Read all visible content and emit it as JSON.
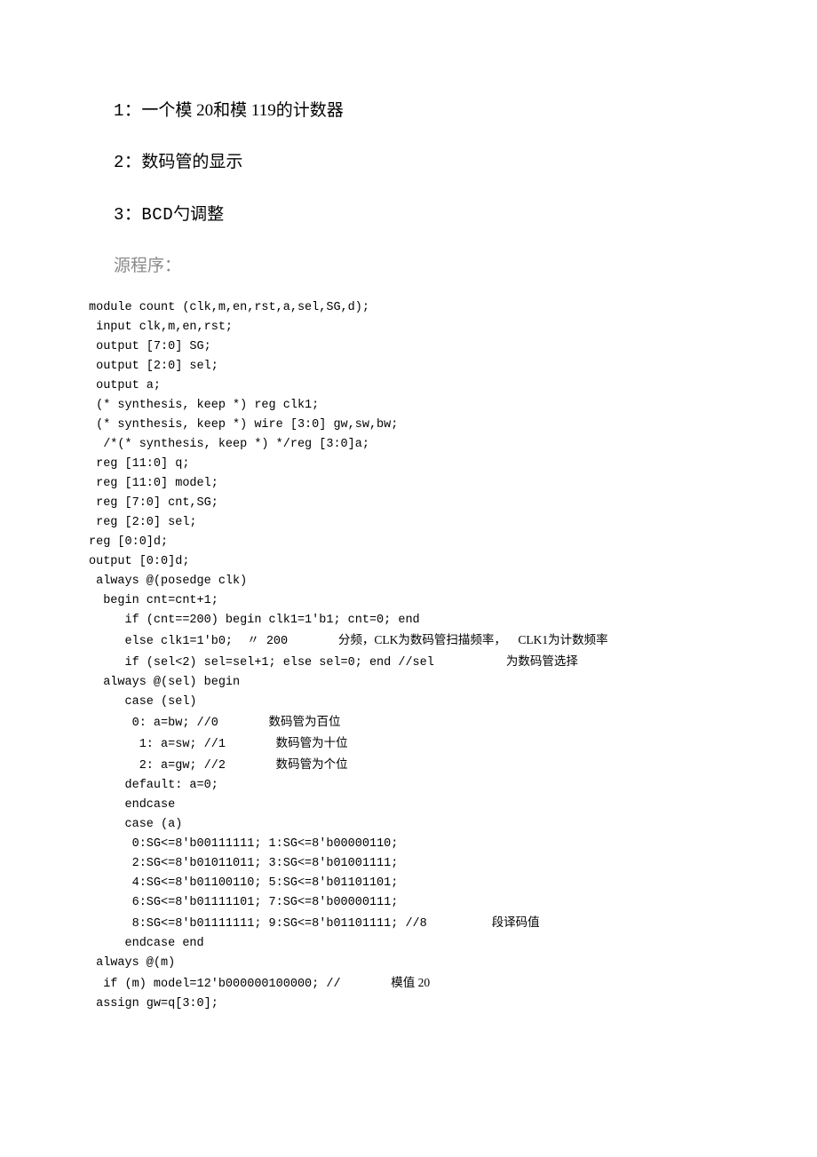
{
  "headings": {
    "h1_num": "1：",
    "h1_text": "一个模 20和模 119的计数器",
    "h2_num": "2：",
    "h2_text": "数码管的显示",
    "h3_num": "3：BCD",
    "h3_text": "勺调整",
    "src": "源程序："
  },
  "code": {
    "l01": "module count (clk,m,en,rst,a,sel,SG,d);",
    "l02": " input clk,m,en,rst;",
    "l03": " output [7:0] SG;",
    "l04": " output [2:0] sel;",
    "l05": " output a;",
    "l06": " (* synthesis, keep *) reg clk1;",
    "l07": " (* synthesis, keep *) wire [3:0] gw,sw,bw;",
    "l08": "  /*(* synthesis, keep *) */reg [3:0]a;",
    "l09": " reg [11:0] q;",
    "l10": " reg [11:0] model;",
    "l11": " reg [7:0] cnt,SG;",
    "l12": " reg [2:0] sel;",
    "l13": "reg [0:0]d;",
    "l14": "output [0:0]d;",
    "l15": " always @(posedge clk)",
    "l16": "  begin cnt=cnt+1;",
    "l17": "     if (cnt==200) begin clk1=1'b1; cnt=0; end",
    "l18a": "     else clk1=1'b0;  〃 200       ",
    "l18b": "分频，CLK为数码管扫描频率，    CLK1为计数频率",
    "l19a": "     if (sel<2) sel=sel+1; else sel=0; end //sel          ",
    "l19b": "为数码管选择",
    "l20": "  always @(sel) begin",
    "l21": "     case (sel)",
    "l22a": "      0: a=bw; //0       ",
    "l22b": "数码管为百位",
    "l23a": "       1: a=sw; //1       ",
    "l23b": "数码管为十位",
    "l24a": "       2: a=gw; //2       ",
    "l24b": "数码管为个位",
    "l25": "     default: a=0;",
    "l26": "     endcase",
    "l27": "     case (a)",
    "l28": "      0:SG<=8'b00111111; 1:SG<=8'b00000110;",
    "l29": "      2:SG<=8'b01011011; 3:SG<=8'b01001111;",
    "l30": "      4:SG<=8'b01100110; 5:SG<=8'b01101101;",
    "l31": "      6:SG<=8'b01111101; 7:SG<=8'b00000111;",
    "l32a": "      8:SG<=8'b01111111; 9:SG<=8'b01101111; //8         ",
    "l32b": "段译码值",
    "l33": "     endcase end",
    "l34": " always @(m)",
    "l35a": "  if (m) model=12'b000000100000; //       ",
    "l35b": "模值 20",
    "l36": " assign gw=q[3:0];"
  }
}
